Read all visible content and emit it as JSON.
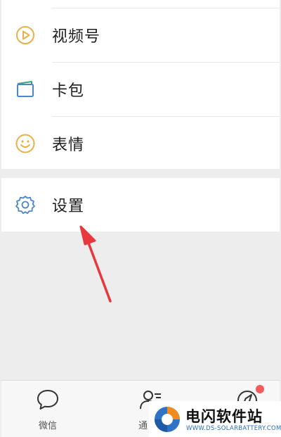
{
  "menu": {
    "items": [
      {
        "label": "视频号",
        "icon": "channels-play-icon"
      },
      {
        "label": "卡包",
        "icon": "card-wallet-icon"
      },
      {
        "label": "表情",
        "icon": "smiley-face-icon"
      },
      {
        "label": "设置",
        "icon": "gear-icon"
      }
    ]
  },
  "tabbar": {
    "tabs": [
      {
        "label": "微信",
        "icon": "chat-bubble-icon"
      },
      {
        "label": "通",
        "icon": "contacts-icon"
      },
      {
        "label": "",
        "icon": "discover-compass-icon"
      }
    ]
  },
  "watermark": {
    "title": "电闪软件站",
    "subtitle": "WWW.DS-SOLARBATTERY.COM"
  },
  "colors": {
    "accent_orange": "#e8b04a",
    "accent_blue": "#4a86c8",
    "annotation_red": "#e8383d",
    "badge_red": "#f25c5c",
    "background_gray": "#ededed"
  }
}
